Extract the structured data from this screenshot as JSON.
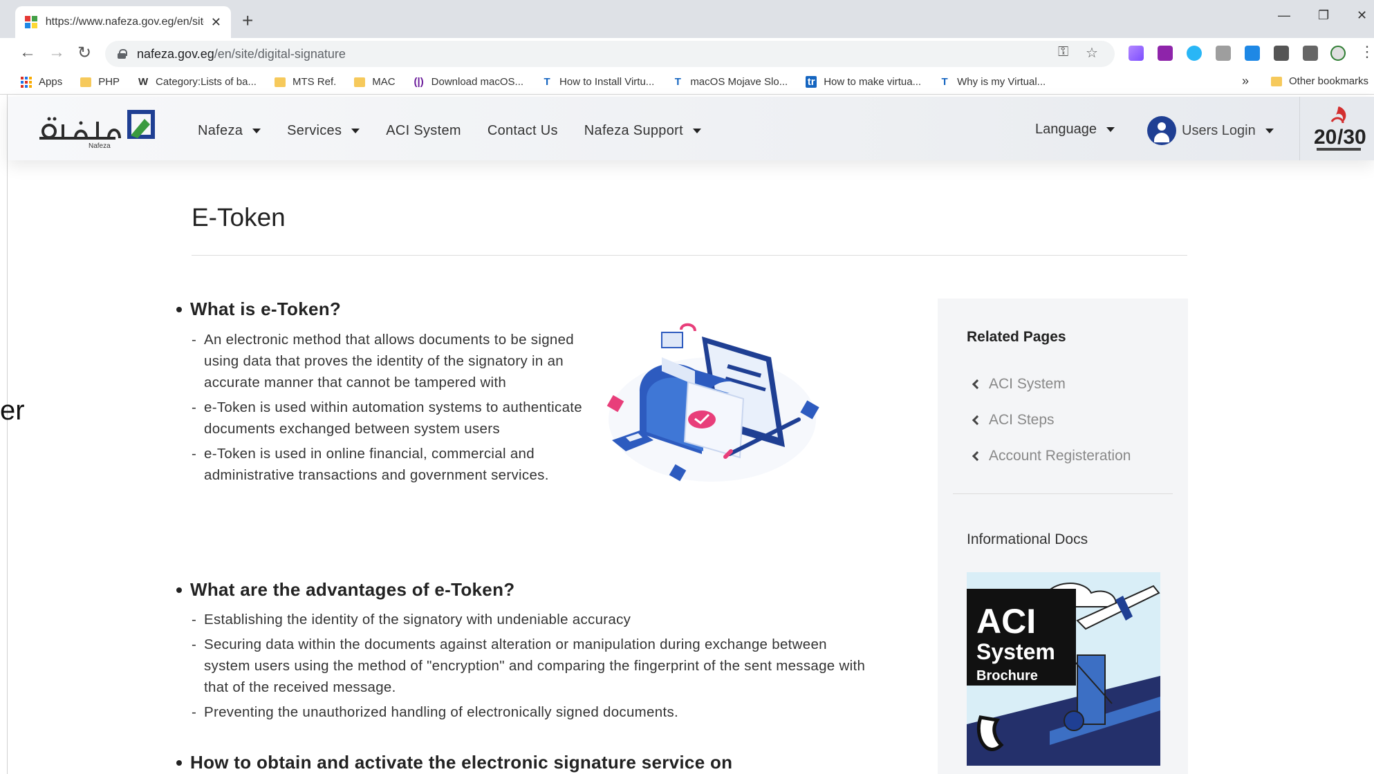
{
  "browser": {
    "tab_title": "https://www.nafeza.gov.eg/en/site/digital-signature",
    "url_host": "nafeza.gov.eg",
    "url_path": "/en/site/digital-signature",
    "bookmarks": [
      {
        "label": "Apps",
        "icon": "apps-grid-icon"
      },
      {
        "label": "PHP",
        "icon": "folder-icon"
      },
      {
        "label": "Category:Lists of ba...",
        "icon": "wikipedia-icon"
      },
      {
        "label": "MTS Ref.",
        "icon": "folder-icon"
      },
      {
        "label": "MAC",
        "icon": "folder-icon"
      },
      {
        "label": "Download macOS...",
        "icon": "site-icon"
      },
      {
        "label": "How to Install Virtu...",
        "icon": "site-icon"
      },
      {
        "label": "macOS Mojave Slo...",
        "icon": "site-icon"
      },
      {
        "label": "How to make virtua...",
        "icon": "site-icon"
      },
      {
        "label": "Why is my Virtual...",
        "icon": "site-icon"
      }
    ],
    "bookmarks_more": "»",
    "other_bookmarks": "Other bookmarks"
  },
  "edge_text": "er",
  "site": {
    "logo_sub": "Nafeza",
    "nav": {
      "nafeza": "Nafeza",
      "services": "Services",
      "aci": "ACI System",
      "contact": "Contact Us",
      "support": "Nafeza Support"
    },
    "language": "Language",
    "users_login": "Users Login"
  },
  "page": {
    "title": "E-Token",
    "section1": {
      "heading": "What is e-Token?",
      "items": [
        "An electronic method that allows documents to be signed using data that proves the identity of the signatory in an accurate manner that cannot be tampered with",
        "e-Token is used within automation systems to authenticate documents exchanged between system users",
        "e-Token is used in online financial, commercial and administrative transactions and government services."
      ]
    },
    "section2": {
      "heading": "What are the advantages of e-Token?",
      "items": [
        "Establishing the identity of the signatory with undeniable accuracy",
        "Securing data within the documents against alteration or manipulation during exchange between system users using the method of \"encryption\" and comparing the fingerprint of the sent message with that of the received message.",
        "Preventing the unauthorized handling of electronically signed documents."
      ]
    },
    "section3": {
      "heading": "How to obtain and activate the electronic signature service on"
    }
  },
  "sidebar": {
    "related_title": "Related Pages",
    "links": [
      "ACI System",
      "ACI Steps",
      "Account Registeration"
    ],
    "docs_title": "Informational Docs",
    "brochure": {
      "line1": "ACI",
      "line2": "System",
      "line3": "Brochure"
    }
  },
  "colors": {
    "accent_blue": "#1f3f93",
    "logo_green": "#3a9a3f",
    "sidebar_bg": "#f4f5f7"
  }
}
